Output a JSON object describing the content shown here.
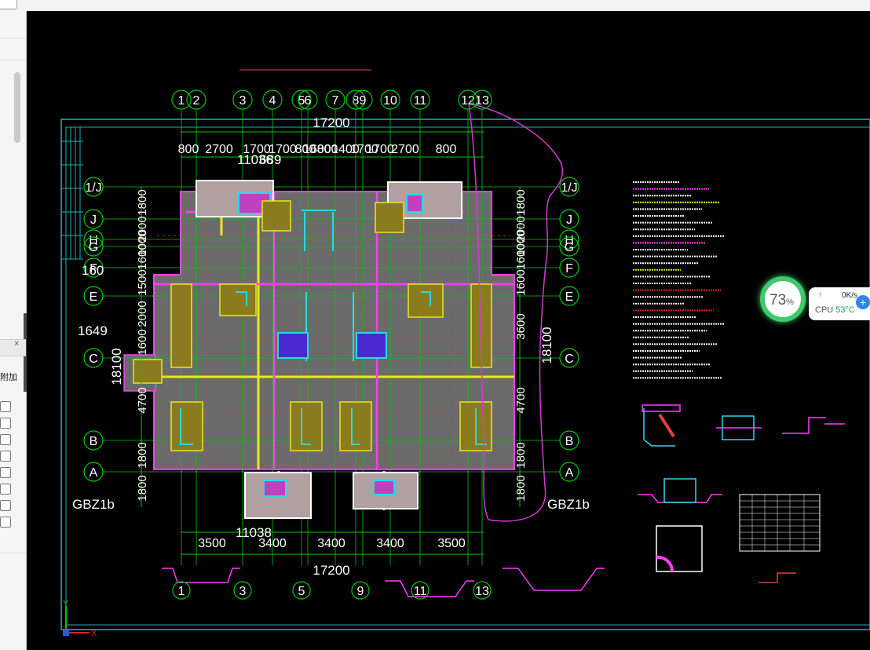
{
  "side_panel": {
    "label": "附加",
    "close_glyph": "×"
  },
  "drawing": {
    "top_total": "17200",
    "bottom_total": "17200",
    "top_dims": [
      "800",
      "2700",
      "1700",
      "1700",
      "800",
      "1600",
      "800",
      "1400",
      "1700",
      "1700",
      "2700",
      "800"
    ],
    "bottom_dims": [
      "3500",
      "3400",
      "3400",
      "3400",
      "3500"
    ],
    "top_grid": [
      "1",
      "2",
      "3",
      "4",
      "5",
      "6",
      "7",
      "8",
      "9",
      "10",
      "11",
      "12",
      "13"
    ],
    "bottom_grid": [
      "1",
      "3",
      "5",
      "9",
      "11",
      "13"
    ],
    "row_axes_left": [
      "1/J",
      "J",
      "H",
      "G",
      "F",
      "E",
      "C",
      "B",
      "A"
    ],
    "row_axes_right": [
      "1/J",
      "J",
      "H",
      "G",
      "F",
      "E",
      "C",
      "B",
      "A"
    ],
    "right_total": "18100",
    "left_total": "18100",
    "left_dims": [
      "1800",
      "2000",
      "1000",
      "1600",
      "1500",
      "2000",
      "1600",
      "4700",
      "1800",
      "1800"
    ],
    "right_dims": [
      "1800",
      "2000",
      "1000",
      "1600",
      "1600",
      "3600",
      "4700",
      "1800",
      "1800"
    ],
    "misc_labels": [
      "1649",
      "160",
      "11036",
      "11038",
      "689",
      "GBZ1b",
      "GBZ1b"
    ],
    "ucs_y": "Y",
    "ucs_x": "X"
  },
  "perf_widget": {
    "percent": "73",
    "percent_unit": "%",
    "net_arrow": "↑",
    "net_speed": "0K/s",
    "cpu_label": "CPU",
    "cpu_temp": "53°C",
    "plus_glyph": "+"
  },
  "colors": {
    "canvas_bg": "#000000",
    "frame": "#1fb0b8",
    "grid": "#00c800",
    "slab": "#6b6b6b",
    "beam_yellow": "#e8e820",
    "beam_magenta": "#ff3cff",
    "column_cyan": "#2ad8e8",
    "block_olive": "#8a7c1e",
    "cpu_ring": "#41c86a"
  }
}
